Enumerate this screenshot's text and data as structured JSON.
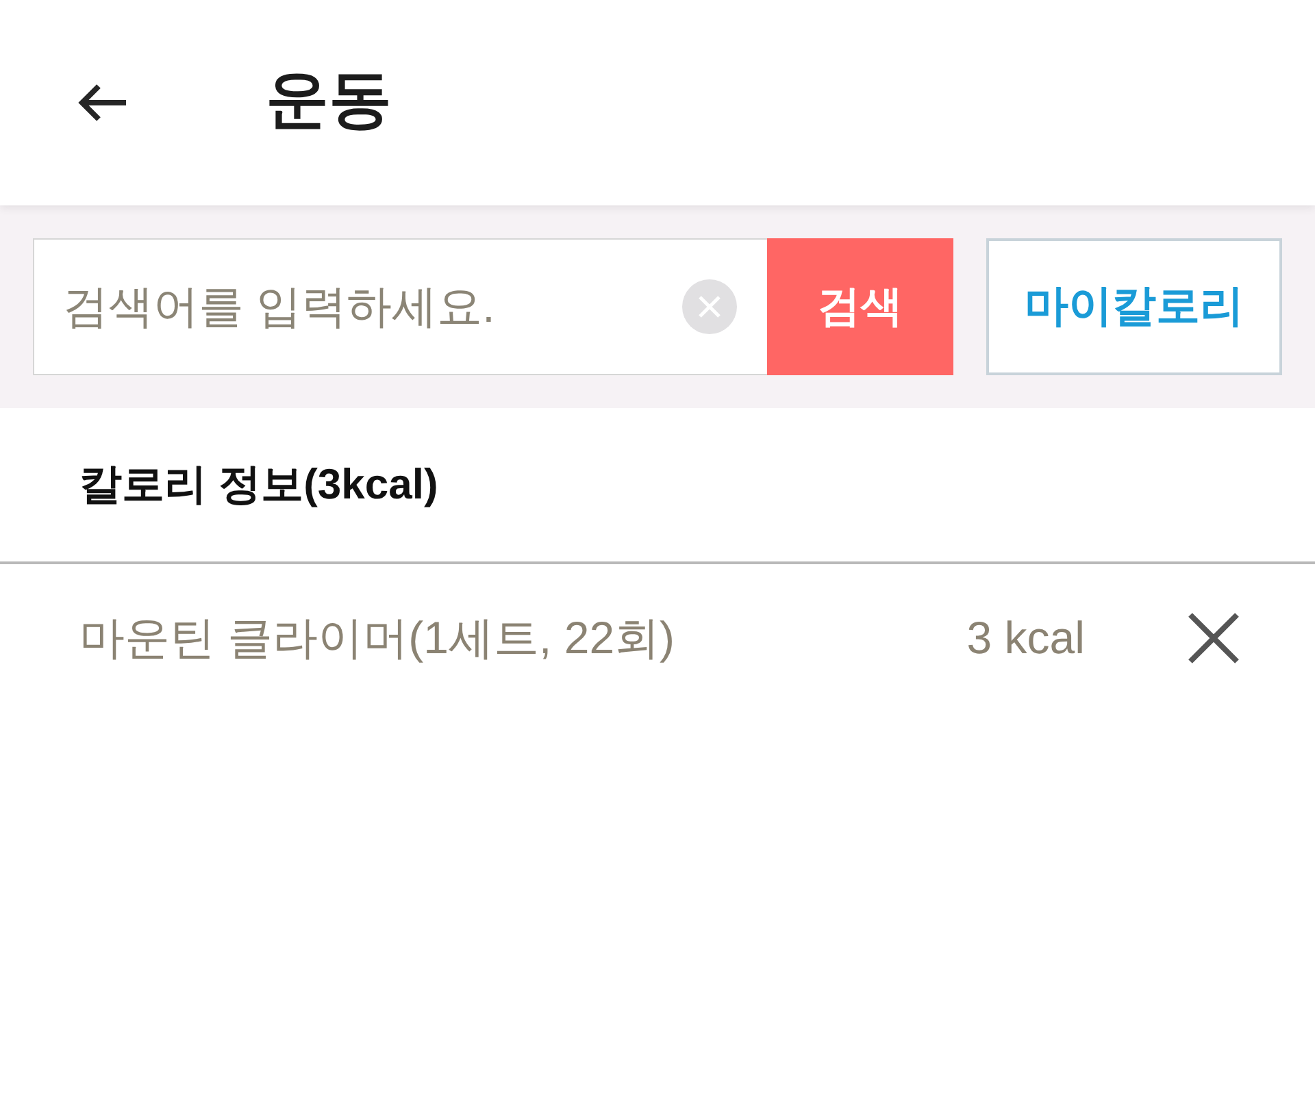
{
  "header": {
    "title": "운동"
  },
  "search": {
    "placeholder": "검색어를 입력하세요.",
    "button": "검색",
    "my_calorie_button": "마이칼로리"
  },
  "calorie_info": {
    "title": "칼로리 정보(3kcal)",
    "items": [
      {
        "name": "마운틴 클라이머(1세트, 22회)",
        "calories": "3 kcal"
      }
    ]
  }
}
